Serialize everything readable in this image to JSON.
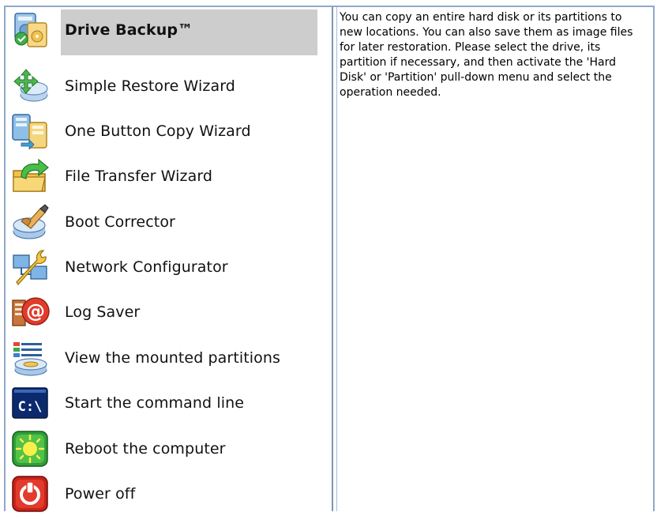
{
  "menu": {
    "items": [
      {
        "label": "Drive Backup™",
        "icon": "drive-backup-icon",
        "selected": true
      },
      {
        "label": "Simple Restore Wizard",
        "icon": "restore-wizard-icon",
        "selected": false
      },
      {
        "label": "One Button Copy Wizard",
        "icon": "copy-wizard-icon",
        "selected": false
      },
      {
        "label": "File Transfer Wizard",
        "icon": "file-transfer-icon",
        "selected": false
      },
      {
        "label": "Boot Corrector",
        "icon": "boot-corrector-icon",
        "selected": false
      },
      {
        "label": "Network Configurator",
        "icon": "network-configurator-icon",
        "selected": false
      },
      {
        "label": "Log Saver",
        "icon": "log-saver-icon",
        "selected": false
      },
      {
        "label": "View the mounted partitions",
        "icon": "mounted-partitions-icon",
        "selected": false
      },
      {
        "label": "Start the command line",
        "icon": "command-line-icon",
        "selected": false
      },
      {
        "label": "Reboot the computer",
        "icon": "reboot-icon",
        "selected": false
      },
      {
        "label": "Power off",
        "icon": "power-off-icon",
        "selected": false
      }
    ]
  },
  "description": {
    "text": "You can copy an entire hard disk or its partitions to new locations. You can also save them as image files for later restoration. Please select the drive, its partition if necessary, and then activate the 'Hard Disk' or 'Partition' pull-down menu and select the operation needed."
  },
  "icons": {
    "cmd_text": "C:\\"
  },
  "colors": {
    "selection": "#cdcdcd",
    "border": "#7c95ba"
  }
}
